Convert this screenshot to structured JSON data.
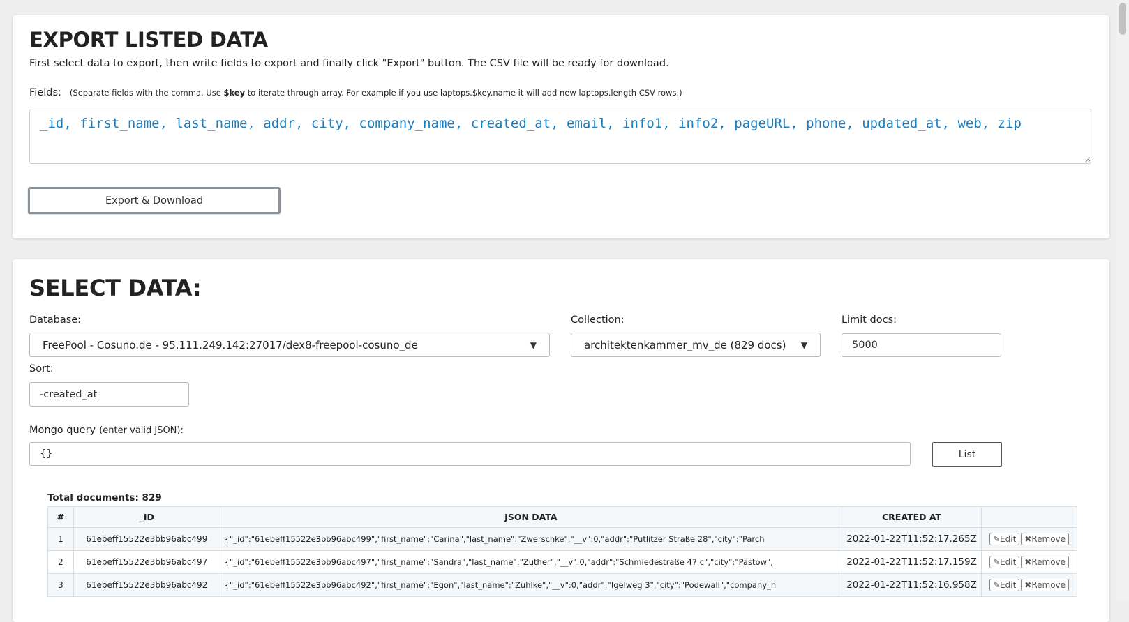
{
  "export_section": {
    "title": "EXPORT LISTED DATA",
    "description": "First select data to export, then write fields to export and finally click \"Export\" button. The CSV file will be ready for download.",
    "fields_label": "Fields:",
    "fields_hint_1": "(Separate fields with the comma. Use ",
    "fields_hint_key": "$key",
    "fields_hint_2": " to iterate through array. For example if you use laptops.$key.name it will add new laptops.length CSV rows.)",
    "fields_value": "_id, first_name, last_name, addr, city, company_name, created_at, email, info1, info2, pageURL, phone, updated_at, web, zip",
    "export_button": "Export & Download"
  },
  "select_section": {
    "title": "SELECT DATA:",
    "database_label": "Database:",
    "database_value": "FreePool - Cosuno.de - 95.111.249.142:27017/dex8-freepool-cosuno_de",
    "collection_label": "Collection:",
    "collection_value": "architektenkammer_mv_de (829 docs)",
    "limit_label": "Limit docs:",
    "limit_value": "5000",
    "sort_label": "Sort:",
    "sort_value": "-created_at",
    "query_label": "Mongo query",
    "query_hint": "(enter valid JSON):",
    "query_value": "{}",
    "list_button": "List",
    "total_documents": "Total documents: 829"
  },
  "table": {
    "headers": [
      "#",
      "_ID",
      "JSON DATA",
      "CREATED AT",
      ""
    ],
    "edit_label": "Edit",
    "remove_label": "Remove",
    "rows": [
      {
        "num": "1",
        "id": "61ebeff15522e3bb96abc499",
        "json": "{\"_id\":\"61ebeff15522e3bb96abc499\",\"first_name\":\"Carina\",\"last_name\":\"Zwerschke\",\"__v\":0,\"addr\":\"Putlitzer Straße 28\",\"city\":\"Parch",
        "created": "2022-01-22T11:52:17.265Z"
      },
      {
        "num": "2",
        "id": "61ebeff15522e3bb96abc497",
        "json": "{\"_id\":\"61ebeff15522e3bb96abc497\",\"first_name\":\"Sandra\",\"last_name\":\"Zuther\",\"__v\":0,\"addr\":\"Schmiedestraße 47 c\",\"city\":\"Pastow\",",
        "created": "2022-01-22T11:52:17.159Z"
      },
      {
        "num": "3",
        "id": "61ebeff15522e3bb96abc492",
        "json": "{\"_id\":\"61ebeff15522e3bb96abc492\",\"first_name\":\"Egon\",\"last_name\":\"Zühlke\",\"__v\":0,\"addr\":\"Igelweg 3\",\"city\":\"Podewall\",\"company_n",
        "created": "2022-01-22T11:52:16.958Z"
      }
    ]
  },
  "icons": {
    "edit": "edit-icon",
    "remove": "times-icon",
    "dropdown": "chevron-down-icon"
  }
}
